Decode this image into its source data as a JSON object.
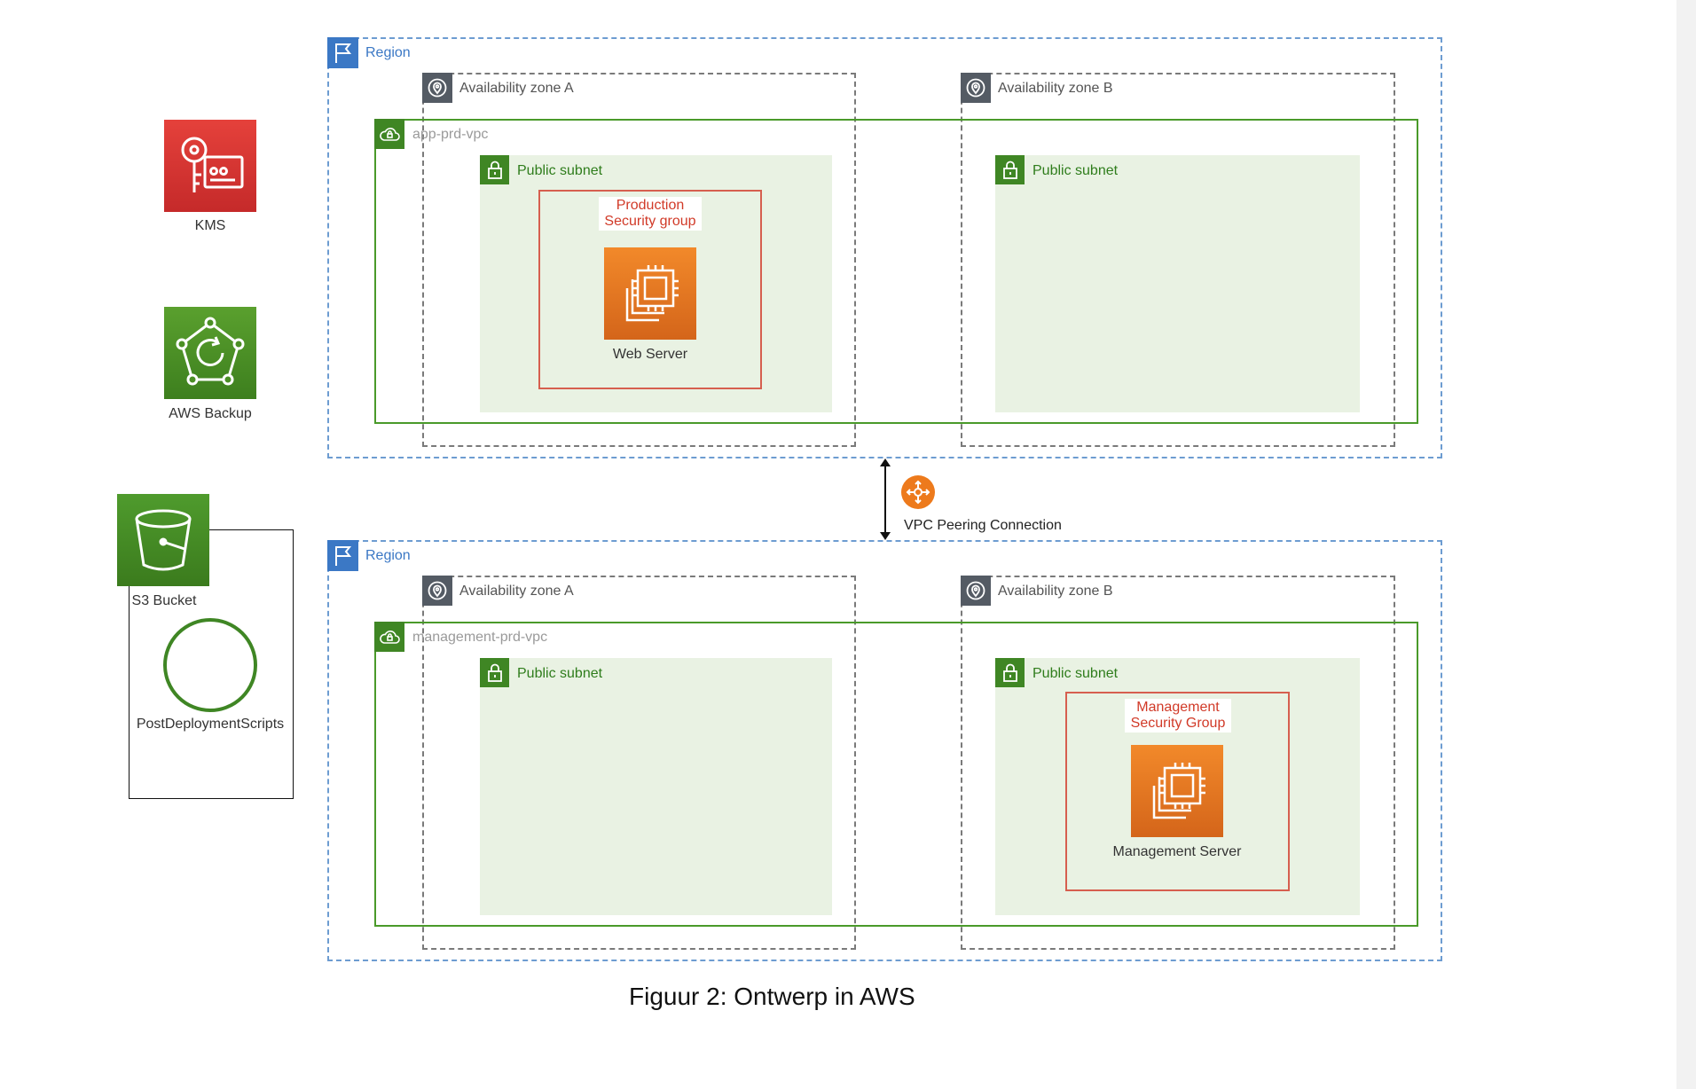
{
  "services": {
    "kms_label": "KMS",
    "backup_label": "AWS Backup",
    "s3_label": "S3 Bucket",
    "scripts_label": "PostDeploymentScripts"
  },
  "regions": [
    {
      "label": "Region",
      "az_a": "Availability zone A",
      "az_b": "Availability zone B",
      "vpc": "app-prd-vpc",
      "subnet_a": "Public subnet",
      "subnet_b": "Public subnet",
      "security_group": "Production\nSecurity group",
      "server": "Web Server"
    },
    {
      "label": "Region",
      "az_a": "Availability zone A",
      "az_b": "Availability zone B",
      "vpc": "management-prd-vpc",
      "subnet_a": "Public subnet",
      "subnet_b": "Public subnet",
      "security_group": "Management\nSecurity Group",
      "server": "Management Server"
    }
  ],
  "peering": {
    "label": "VPC Peering Connection"
  },
  "caption": "Figuur 2: Ontwerp in AWS",
  "icons": {
    "region": "region-flag-icon",
    "az": "location-pin-icon",
    "vpc": "cloud-lock-icon",
    "subnet": "padlock-icon",
    "ec2": "ec2-chip-icon",
    "kms": "key-icon",
    "backup": "backup-icon",
    "s3": "bucket-icon",
    "peering": "peering-icon"
  },
  "colors": {
    "region": "#3b78c5",
    "vpc": "#3f8624",
    "subnet_fill": "#e9f2e3",
    "security_group": "#d13a28",
    "ec2": "#ed7100",
    "kms": "#dd344c"
  }
}
